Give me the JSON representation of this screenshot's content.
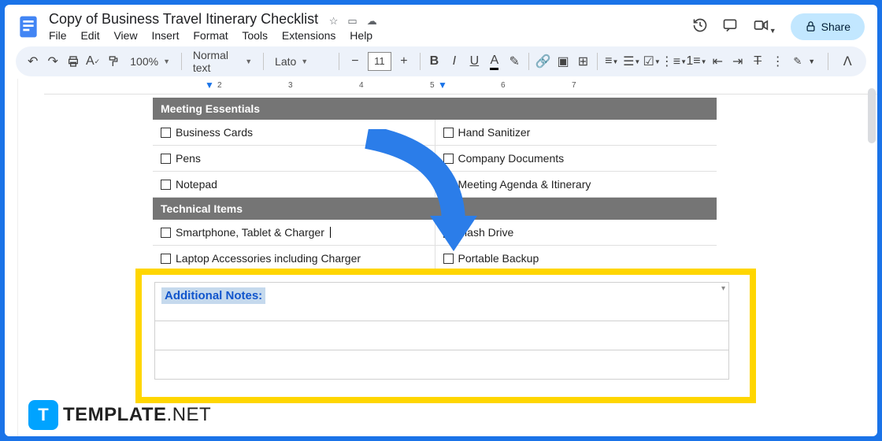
{
  "doc": {
    "title": "Copy of Business Travel Itinerary Checklist"
  },
  "menu": [
    "File",
    "Edit",
    "View",
    "Insert",
    "Format",
    "Tools",
    "Extensions",
    "Help"
  ],
  "share": "Share",
  "toolbar": {
    "zoom": "100%",
    "style": "Normal text",
    "font": "Lato",
    "size": "11"
  },
  "ruler": {
    "marks": [
      "2",
      "3",
      "4",
      "5",
      "6",
      "7"
    ]
  },
  "content": {
    "sec1": "Meeting Essentials",
    "r1a": "Business Cards",
    "r1b": "Hand Sanitizer",
    "r2a": "Pens",
    "r2b": "Company Documents",
    "r3a": "Notepad",
    "r3b": "Meeting Agenda & Itinerary",
    "sec2": "Technical  Items",
    "r4a": "Smartphone, Tablet & Charger",
    "r4b": "Flash Drive",
    "r5a": "Laptop Accessories including Charger",
    "r5b": "Portable Backup"
  },
  "notes": {
    "label": "Additional Notes:"
  },
  "brand": {
    "bold": "TEMPLATE",
    "light": ".NET"
  }
}
